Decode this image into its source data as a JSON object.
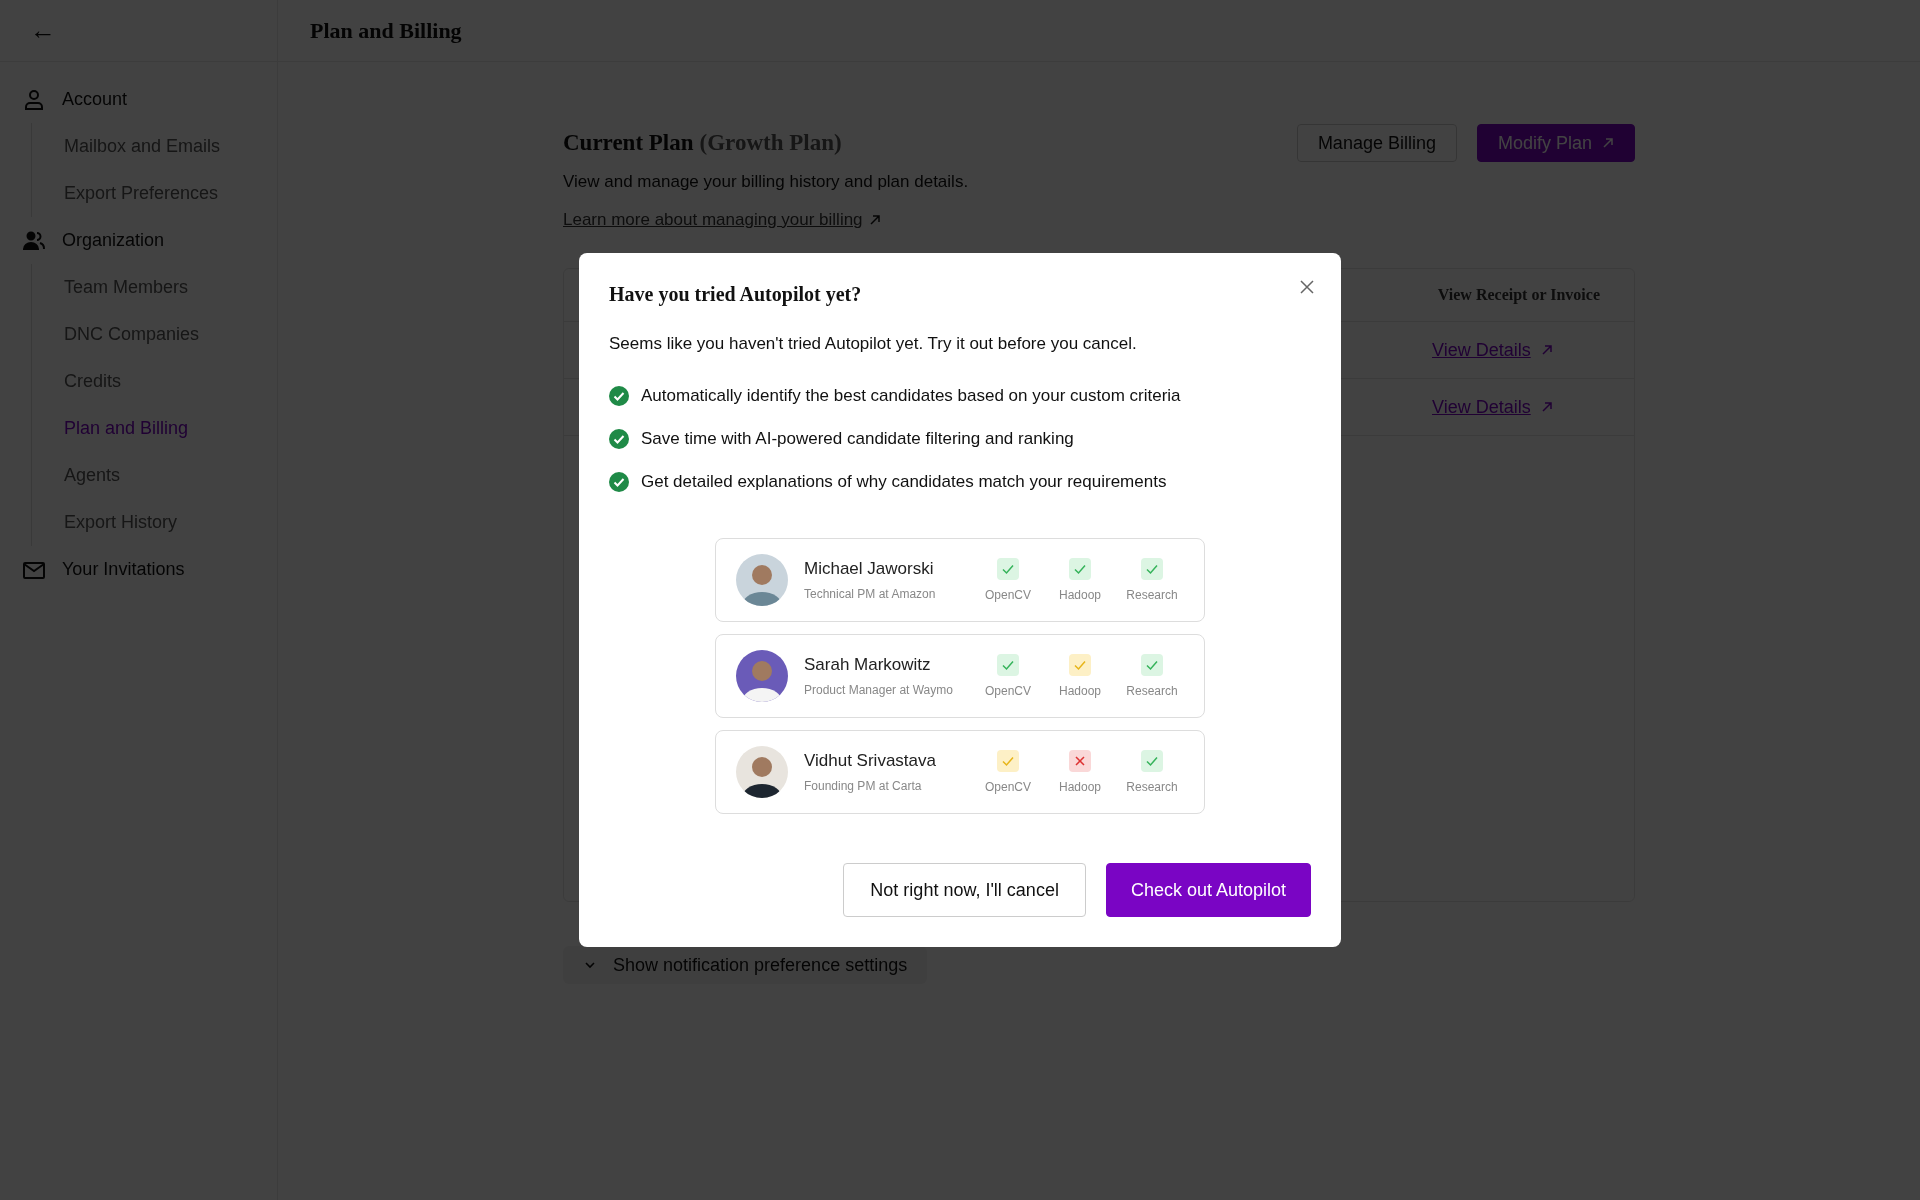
{
  "header": {
    "back": "←",
    "title": "Plan and Billing"
  },
  "sidebar": {
    "groups": [
      {
        "label": "Account",
        "children": [
          {
            "label": "Mailbox and Emails",
            "selected": false
          },
          {
            "label": "Export Preferences",
            "selected": false
          }
        ]
      },
      {
        "label": "Organization",
        "children": [
          {
            "label": "Team Members",
            "selected": false
          },
          {
            "label": "DNC Companies",
            "selected": false
          },
          {
            "label": "Credits",
            "selected": false
          },
          {
            "label": "Plan and Billing",
            "selected": true
          },
          {
            "label": "Agents",
            "selected": false
          },
          {
            "label": "Export History",
            "selected": false
          }
        ]
      },
      {
        "label": "Your Invitations"
      }
    ]
  },
  "plan": {
    "title": "Current Plan",
    "plan_name": "(Growth Plan)",
    "description": "View and manage your billing history and plan details.",
    "link": "Learn more about managing your billing",
    "buttons": [
      {
        "label": "Manage Billing",
        "kind": "outline"
      },
      {
        "label": "Modify Plan",
        "kind": "primary"
      }
    ]
  },
  "table": {
    "columns": [
      "View Receipt or Invoice"
    ],
    "rows": [
      {
        "link": "View Details"
      },
      {
        "link": "View Details"
      }
    ]
  },
  "notification_toggle": {
    "label": "Show notification preference settings",
    "expanded": false
  },
  "modal": {
    "title": "Have you tried Autopilot yet?",
    "subtitle": "Seems like you haven't tried Autopilot yet. Try it out before you cancel.",
    "benefits": [
      "Automatically identify the best candidates based on your custom criteria",
      "Save time with AI-powered candidate filtering and ranking",
      "Get detailed explanations of why candidates match your requirements"
    ],
    "candidates": [
      {
        "name": "Michael Jaworski",
        "role": "Technical PM at Amazon",
        "skills": [
          {
            "label": "OpenCV",
            "kind": "match"
          },
          {
            "label": "Hadoop",
            "kind": "match"
          },
          {
            "label": "Research",
            "kind": "match"
          }
        ]
      },
      {
        "name": "Sarah Markowitz",
        "role": "Product Manager at Waymo",
        "skills": [
          {
            "label": "OpenCV",
            "kind": "match"
          },
          {
            "label": "Hadoop",
            "kind": "partial"
          },
          {
            "label": "Research",
            "kind": "match"
          }
        ]
      },
      {
        "name": "Vidhut Srivastava",
        "role": "Founding PM at Carta",
        "skills": [
          {
            "label": "OpenCV",
            "kind": "partial"
          },
          {
            "label": "Hadoop",
            "kind": "miss"
          },
          {
            "label": "Research",
            "kind": "match"
          }
        ]
      }
    ],
    "buttons": [
      {
        "label": "Not right now, I'll cancel",
        "kind": "outline"
      },
      {
        "label": "Check out Autopilot",
        "kind": "primary"
      }
    ]
  }
}
